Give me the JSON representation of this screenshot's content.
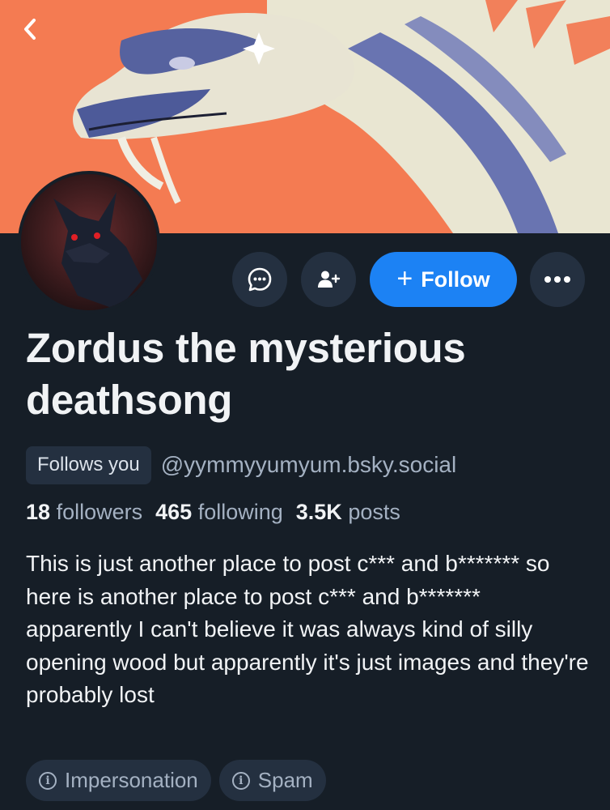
{
  "profile": {
    "display_name": "Zordus the mysterious deathsong",
    "follows_you_badge": "Follows you",
    "handle": "@yymmyyumyum.bsky.social",
    "stats": {
      "followers_count": "18",
      "followers_label": "followers",
      "following_count": "465",
      "following_label": "following",
      "posts_count": "3.5K",
      "posts_label": "posts"
    },
    "bio": "This is just another place to post c*** and b******* so here is another place to post c*** and b******* apparently I can't believe it was always kind of silly opening wood but apparently it's just images and they're probably lost"
  },
  "actions": {
    "follow_label": "Follow",
    "follow_icon": "plus-icon",
    "message_icon": "chat-bubble-icon",
    "suggest_icon": "person-plus-icon",
    "more_icon": "ellipsis-icon",
    "back_icon": "chevron-left-icon"
  },
  "labels": [
    {
      "text": "Impersonation",
      "icon": "info-icon"
    },
    {
      "text": "Spam",
      "icon": "info-icon"
    }
  ],
  "colors": {
    "background": "#161e27",
    "accent": "#1c82f4",
    "chip": "#243040",
    "muted_text": "#a4b1c2",
    "banner_bg": "#f47b52"
  }
}
